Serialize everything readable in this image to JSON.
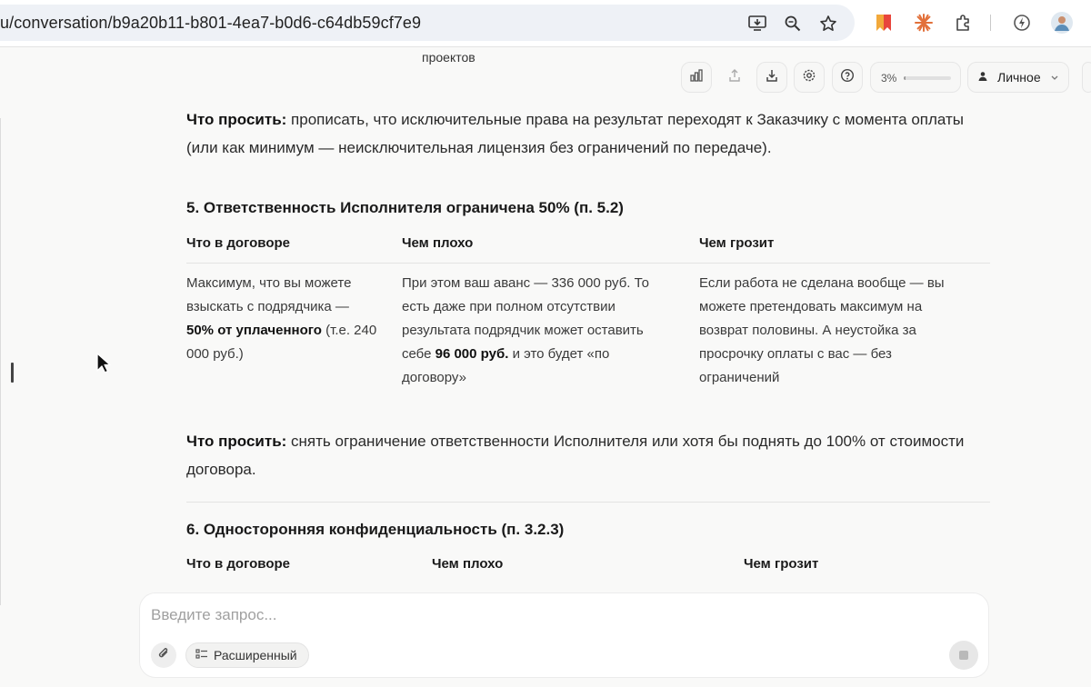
{
  "browser": {
    "url": "u/conversation/b9a20b11-b801-4ea7-b0d6-c64db59cf7e9",
    "url_icons": [
      "install-app-icon",
      "zoom-icon",
      "bookmark-star-icon"
    ],
    "extension_icons": [
      "bookmark-flag-icon",
      "sparkle-extension-icon",
      "puzzle-extensions-icon",
      "refresh-bolt-icon",
      "profile-avatar-icon"
    ]
  },
  "header": {
    "projects_label": "проектов",
    "toolbar_icons": [
      "stats-icon",
      "share-icon",
      "download-icon",
      "settings-icon",
      "help-icon"
    ],
    "usage_label": "3%",
    "usage_fraction": 0.03,
    "profile_label": "Личное"
  },
  "content": {
    "intro": {
      "label": "Что просить:",
      "text": " прописать, что исключительные права на результат переходят к Заказчику с момента оплаты (или как минимум — неисключительная лицензия без ограничений по передаче)."
    },
    "section5": {
      "title": "5. Ответственность Исполнителя ограничена 50% (п. 5.2)",
      "headers": [
        "Что в договоре",
        "Чем плохо",
        "Чем грозит"
      ],
      "col1": {
        "a": "Максимум, что вы можете взыскать с подрядчика — ",
        "b": "50% от уплаченного",
        "c": " (т.е. 240 000 руб.)"
      },
      "col2": {
        "a": "При этом ваш аванс — 336 000 руб. То есть даже при полном отсутствии результата подрядчик может оставить себе ",
        "b": "96 000 руб.",
        "c": " и это будет «по договору»"
      },
      "col3": "Если работа не сделана вообще — вы можете претендовать максимум на возврат половины. А неустойка за просрочку оплаты с вас — без ограничений",
      "ask_label": "Что просить:",
      "ask_text": " снять ограничение ответственности Исполнителя или хотя бы поднять до 100% от стоимости договора."
    },
    "section6": {
      "title": "6. Односторонняя конфиденциальность (п. 3.2.3)",
      "headers": [
        "Что в договоре",
        "Чем плохо",
        "Чем грозит"
      ]
    }
  },
  "composer": {
    "placeholder": "Введите запрос...",
    "mode_label": "Расширенный"
  }
}
